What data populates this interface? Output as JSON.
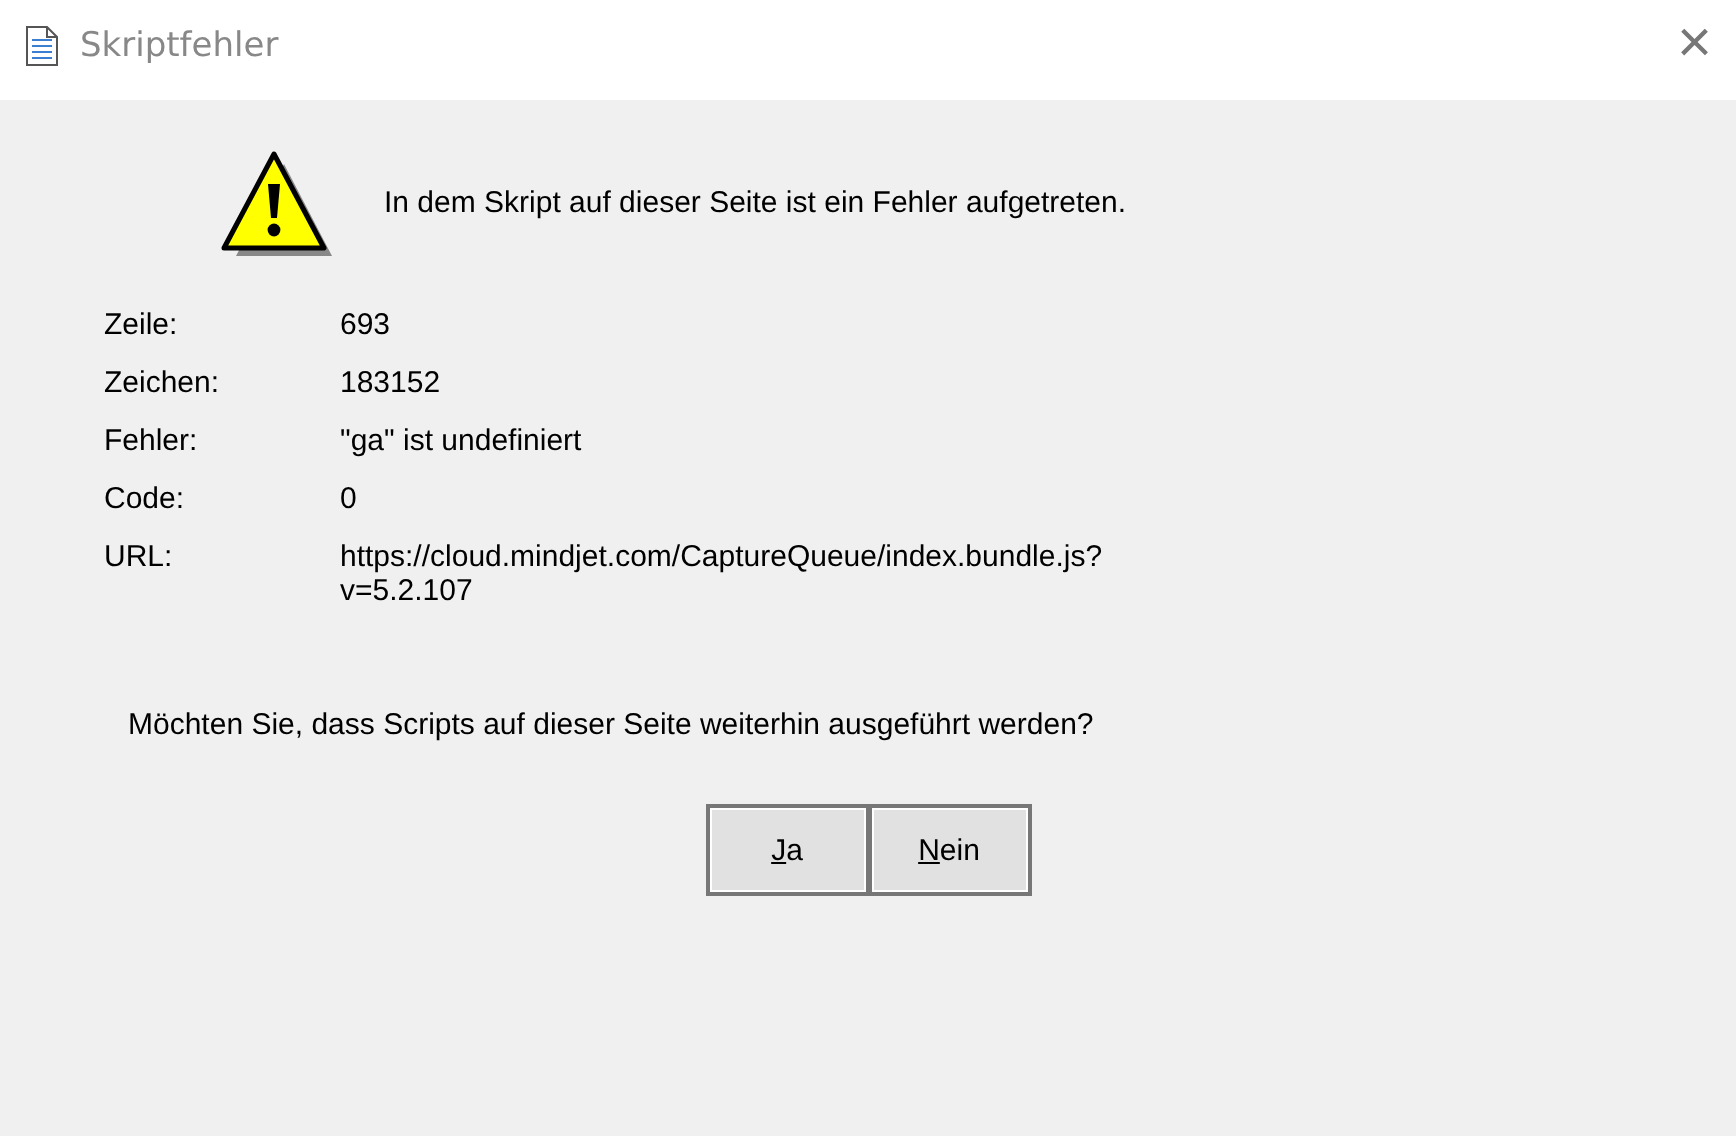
{
  "window": {
    "title": "Skriptfehler",
    "close": "×"
  },
  "message": "In dem Skript auf dieser Seite ist ein Fehler aufgetreten.",
  "details": [
    {
      "label": "Zeile:",
      "value": "693"
    },
    {
      "label": "Zeichen:",
      "value": "183152"
    },
    {
      "label": "Fehler:",
      "value": "\"ga\" ist undefiniert"
    },
    {
      "label": "Code:",
      "value": "0"
    },
    {
      "label": "URL:",
      "value": "https://cloud.mindjet.com/CaptureQueue/index.bundle.js?\nv=5.2.107"
    }
  ],
  "question": "Möchten Sie, dass Scripts auf dieser Seite weiterhin ausgeführt werden?",
  "buttons": [
    {
      "hotkey": "J",
      "rest": "a"
    },
    {
      "hotkey": "N",
      "rest": "ein"
    }
  ]
}
